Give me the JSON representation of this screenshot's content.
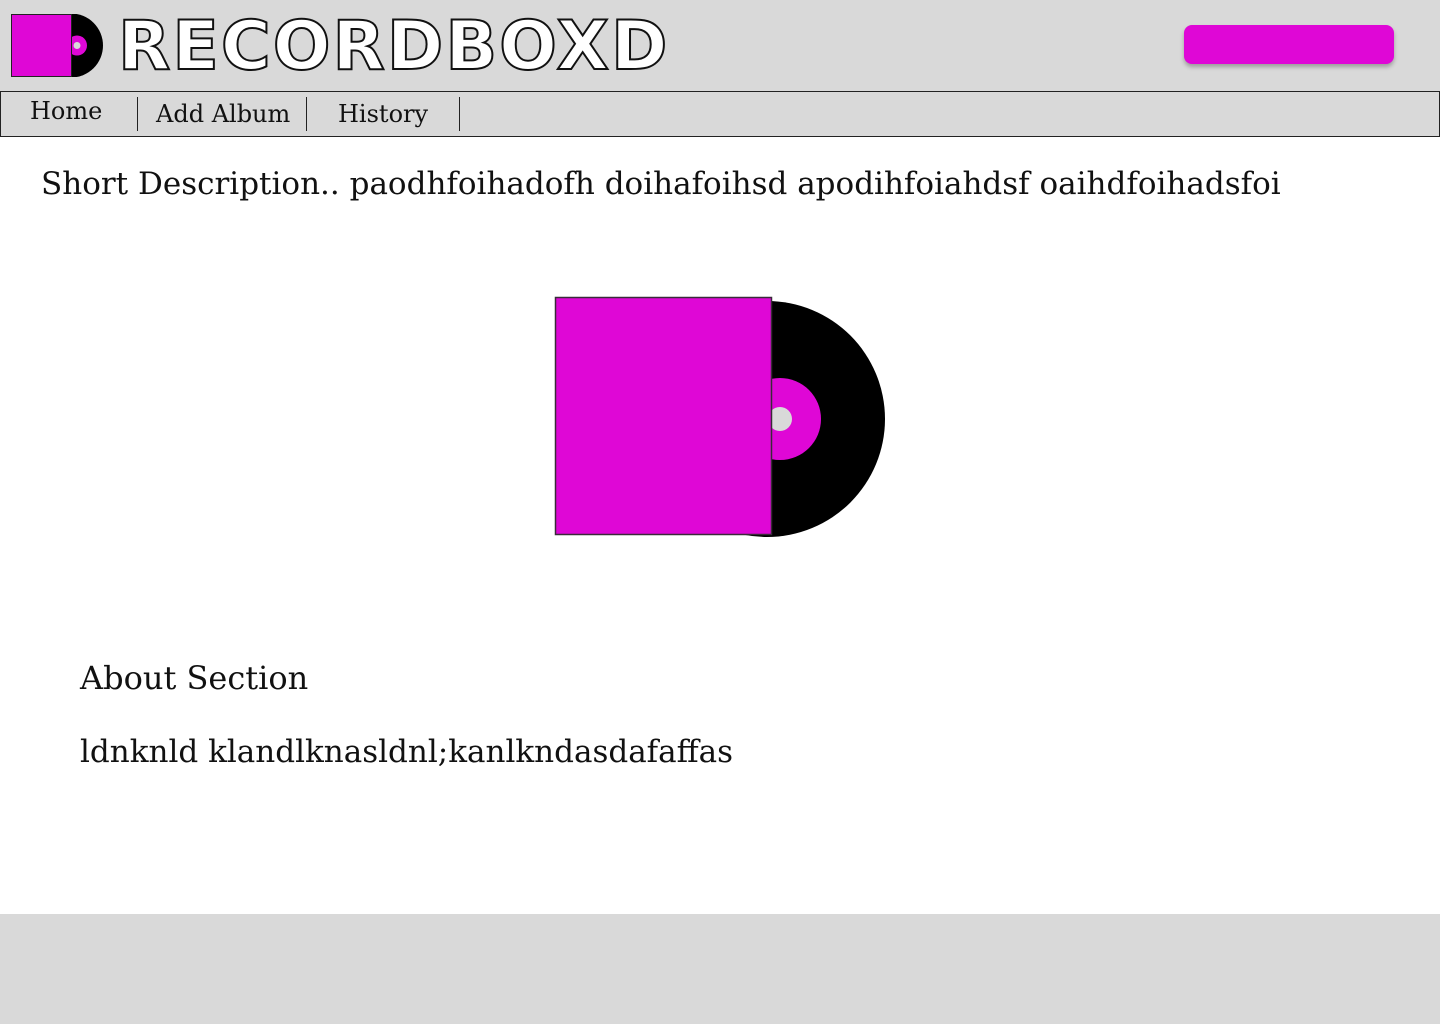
{
  "brand": {
    "title": "RECORDBOXD",
    "logo_icon": "vinyl-record-sleeve-icon",
    "accent_color": "#df07d6",
    "header_bg": "#d9d9d9"
  },
  "header": {
    "cta_label": ""
  },
  "nav": {
    "items": [
      {
        "label": "Home"
      },
      {
        "label": "Add Album"
      },
      {
        "label": "History"
      }
    ]
  },
  "main": {
    "short_description": "Short Description.. paodhfoihadofh doihafoihsd apodihfoiahdsf oaihdfoihadsfoi",
    "album_art_icon": "vinyl-record-sleeve-icon",
    "about": {
      "heading": "About Section",
      "body": "ldnknld klandlknasldnl;kanlkndasdafaffas"
    }
  },
  "footer": {}
}
